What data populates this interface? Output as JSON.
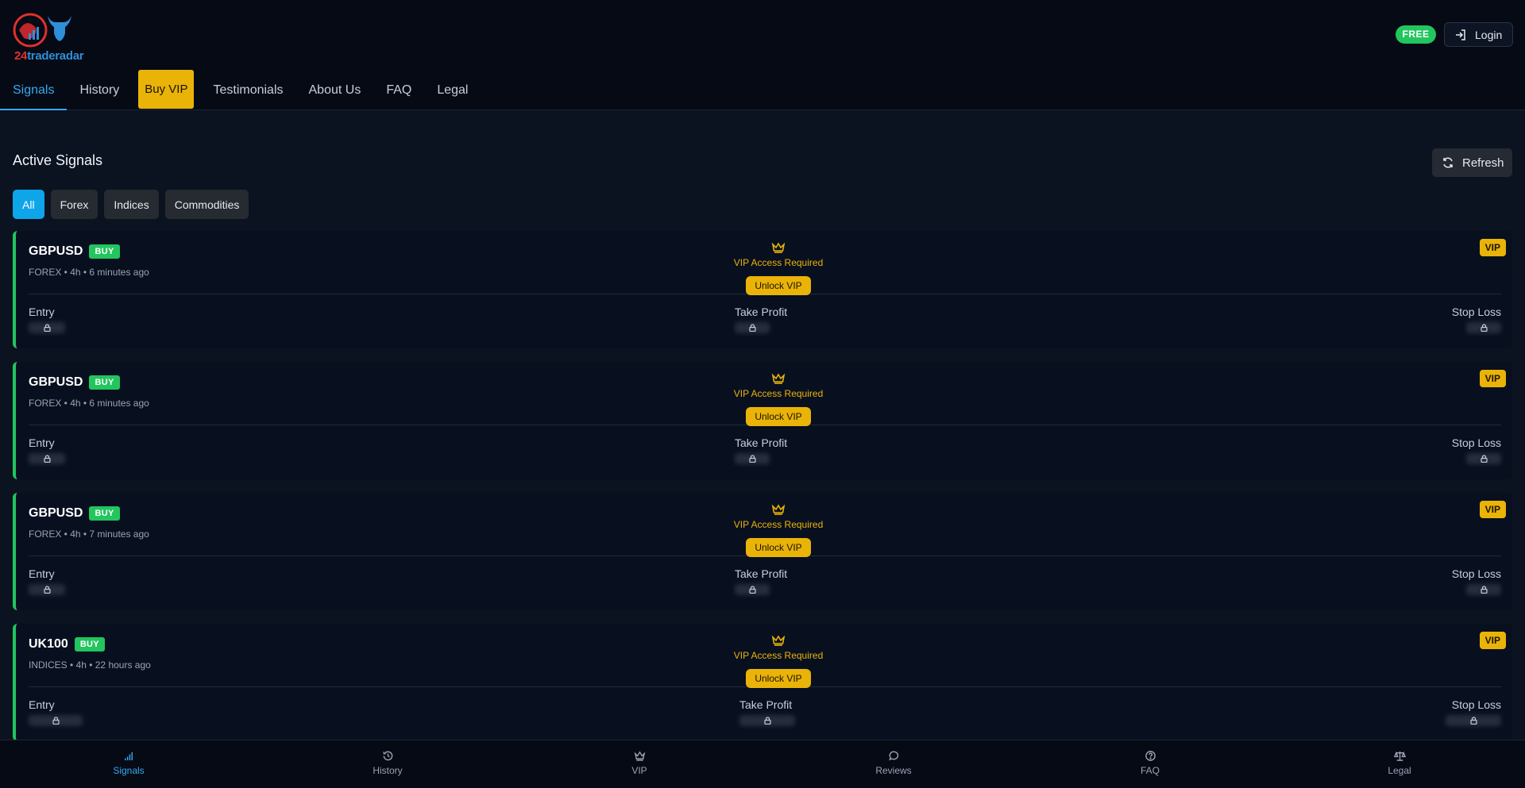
{
  "brand": {
    "num": "24",
    "name": "traderadar"
  },
  "header": {
    "plan_badge": "FREE",
    "login_label": "Login"
  },
  "nav": [
    {
      "label": "Signals",
      "active": true
    },
    {
      "label": "History"
    },
    {
      "label": "Buy VIP",
      "highlight": true
    },
    {
      "label": "Testimonials"
    },
    {
      "label": "About Us"
    },
    {
      "label": "FAQ"
    },
    {
      "label": "Legal"
    }
  ],
  "main": {
    "title": "Active Signals",
    "refresh_label": "Refresh",
    "filters": [
      "All",
      "Forex",
      "Indices",
      "Commodities"
    ],
    "active_filter": "All"
  },
  "signals": [
    {
      "symbol": "GBPUSD",
      "side": "BUY",
      "meta": "FOREX • 4h • 6 minutes ago",
      "vip_tag": "VIP",
      "vip_required": "VIP Access Required",
      "unlock": "Unlock VIP",
      "entry_label": "Entry",
      "tp_label": "Take Profit",
      "sl_label": "Stop Loss"
    },
    {
      "symbol": "GBPUSD",
      "side": "BUY",
      "meta": "FOREX • 4h • 6 minutes ago",
      "vip_tag": "VIP",
      "vip_required": "VIP Access Required",
      "unlock": "Unlock VIP",
      "entry_label": "Entry",
      "tp_label": "Take Profit",
      "sl_label": "Stop Loss"
    },
    {
      "symbol": "GBPUSD",
      "side": "BUY",
      "meta": "FOREX • 4h • 7 minutes ago",
      "vip_tag": "VIP",
      "vip_required": "VIP Access Required",
      "unlock": "Unlock VIP",
      "entry_label": "Entry",
      "tp_label": "Take Profit",
      "sl_label": "Stop Loss"
    },
    {
      "symbol": "UK100",
      "side": "BUY",
      "meta": "INDICES • 4h • 22 hours ago",
      "vip_tag": "VIP",
      "vip_required": "VIP Access Required",
      "unlock": "Unlock VIP",
      "entry_label": "Entry",
      "tp_label": "Take Profit",
      "sl_label": "Stop Loss"
    }
  ],
  "bottom_nav": [
    {
      "label": "Signals",
      "icon": "bar-chart-icon",
      "active": true
    },
    {
      "label": "History",
      "icon": "history-icon"
    },
    {
      "label": "VIP",
      "icon": "crown-icon"
    },
    {
      "label": "Reviews",
      "icon": "chat-bubble-icon"
    },
    {
      "label": "FAQ",
      "icon": "help-circle-icon"
    },
    {
      "label": "Legal",
      "icon": "scale-icon"
    }
  ],
  "colors": {
    "accent": "#3aa8f0",
    "vip": "#eab308",
    "buy": "#22c55e",
    "background": "#0b1220"
  }
}
